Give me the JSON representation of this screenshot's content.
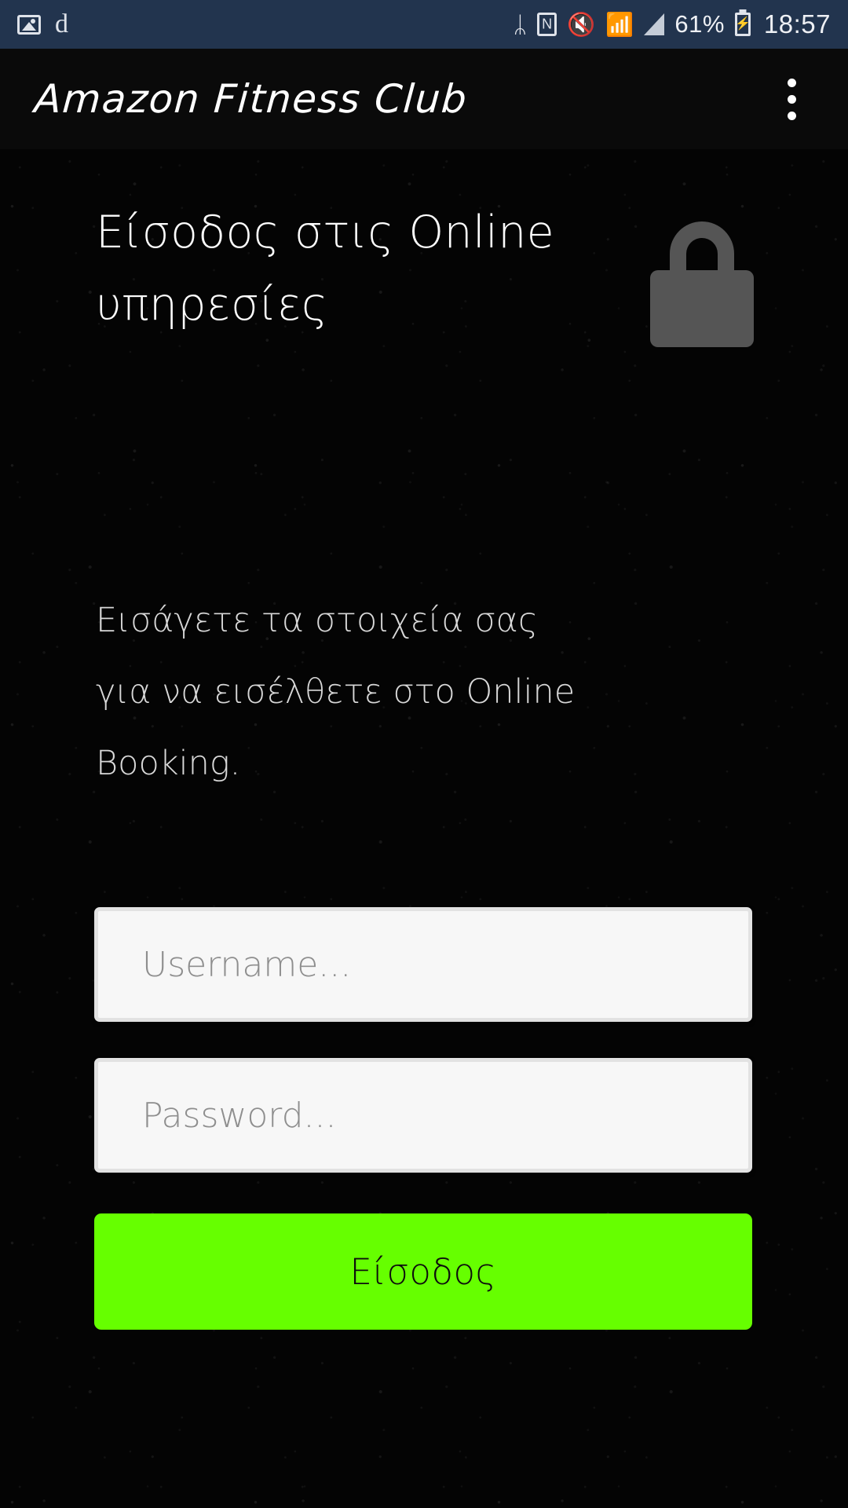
{
  "status_bar": {
    "background": "#22344e",
    "left_icons": [
      {
        "name": "gallery-icon",
        "label": "image"
      },
      {
        "name": "app-d-icon",
        "label": "d"
      }
    ],
    "right_icons": [
      {
        "name": "bluetooth-icon",
        "glyph": "ᛦ"
      },
      {
        "name": "nfc-icon",
        "glyph": "N"
      },
      {
        "name": "volume-mute-icon",
        "glyph": "⏷"
      },
      {
        "name": "wifi-icon",
        "glyph": "◠"
      },
      {
        "name": "cellular-signal-icon",
        "glyph": "◢"
      }
    ],
    "battery_percent": "61%",
    "time": "18:57"
  },
  "app_bar": {
    "title": "Amazon Fitness Club",
    "overflow_label": "More options"
  },
  "login": {
    "heading": "Είσοδος στις Online υπηρεσίες",
    "lock_icon": "lock-icon",
    "description": "Εισάγετε τα στοιχεία σας για να εισέλθετε στο Online Booking.",
    "username_placeholder": "Username...",
    "username_value": "",
    "password_placeholder": "Password...",
    "password_value": "",
    "submit_label": "Είσοδος",
    "accent_color": "#66ff00",
    "field_background": "#f7f7f7",
    "background_color": "#040404"
  }
}
